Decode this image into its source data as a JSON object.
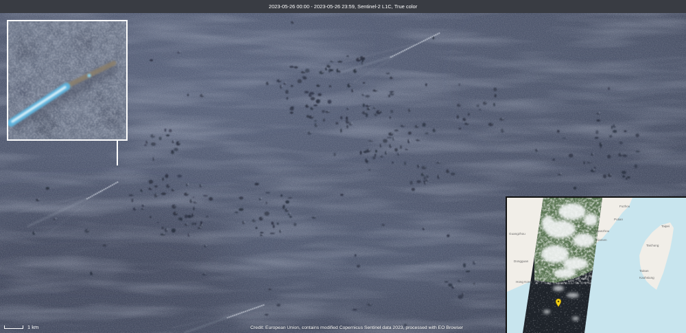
{
  "header": {
    "title": "2023-05-26 00:00 - 2023-05-26 23:59, Sentinel-2 L1C, True color"
  },
  "scale_bar": {
    "label": "1 km"
  },
  "credit": {
    "text": "Credit: European Union, contains modified Copernicus Sentinel data 2023, processed with EO Browser"
  },
  "overview_map": {
    "labels": [
      "Fuzhou",
      "Putian",
      "Quanzhou",
      "Xiamen",
      "Taipei",
      "Taichung",
      "Tainan",
      "Kaohsiung",
      "Guangzhou",
      "Dongguan",
      "Hong Kong"
    ],
    "marker_icon": "location-pin-icon"
  },
  "colors": {
    "ocean": "#4a5268",
    "header_bg": "#393c43",
    "inset_border": "#ffffff",
    "map_sea": "#c8e5ee",
    "map_land": "#f1eee8",
    "marker": "#f2cf16",
    "text_light": "#ffffff"
  }
}
